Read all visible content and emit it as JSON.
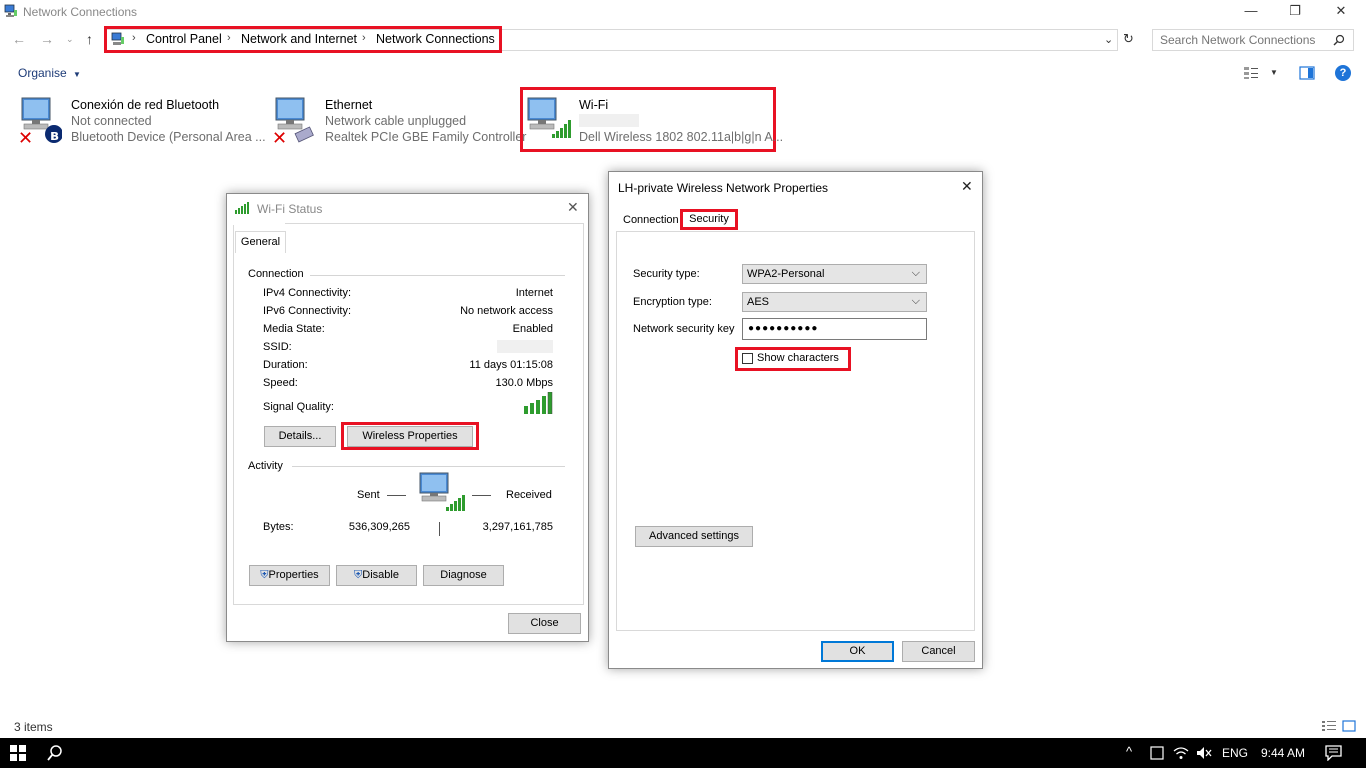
{
  "window": {
    "title": "Network Connections",
    "controls": {
      "minimize": "—",
      "maximize": "❐",
      "close": "✕"
    }
  },
  "address": {
    "crumbs": [
      "Control Panel",
      "Network and Internet",
      "Network Connections"
    ],
    "separator": "›"
  },
  "search": {
    "placeholder": "Search Network Connections"
  },
  "toolbar": {
    "organise_label": "Organise",
    "help_label": "?"
  },
  "connections": [
    {
      "name": "Conexión de red Bluetooth",
      "status": "Not connected",
      "device": "Bluetooth Device (Personal Area ..."
    },
    {
      "name": "Ethernet",
      "status": "Network cable unplugged",
      "device": "Realtek PCIe GBE Family Controller"
    },
    {
      "name": "Wi-Fi",
      "status": "",
      "device": "Dell Wireless 1802 802.11a|b|g|n A..."
    }
  ],
  "wifi_status": {
    "title": "Wi-Fi Status",
    "tab": "General",
    "connection_group": "Connection",
    "rows": [
      {
        "label": "IPv4 Connectivity:",
        "value": "Internet"
      },
      {
        "label": "IPv6 Connectivity:",
        "value": "No network access"
      },
      {
        "label": "Media State:",
        "value": "Enabled"
      },
      {
        "label": "SSID:",
        "value": ""
      },
      {
        "label": "Duration:",
        "value": "11 days 01:15:08"
      },
      {
        "label": "Speed:",
        "value": "130.0 Mbps"
      }
    ],
    "signal_label": "Signal Quality:",
    "details_btn": "Details...",
    "wireless_props_btn": "Wireless Properties",
    "activity_group": "Activity",
    "sent_label": "Sent",
    "received_label": "Received",
    "bytes_label": "Bytes:",
    "bytes_sent": "536,309,265",
    "bytes_received": "3,297,161,785",
    "properties_btn": "Properties",
    "disable_btn": "Disable",
    "diagnose_btn": "Diagnose",
    "close_btn": "Close"
  },
  "wireless_props": {
    "title": "LH-private Wireless Network Properties",
    "tabs": [
      "Connection",
      "Security"
    ],
    "security_type_label": "Security type:",
    "security_type_value": "WPA2-Personal",
    "encryption_type_label": "Encryption type:",
    "encryption_type_value": "AES",
    "key_label": "Network security key",
    "key_value": "●●●●●●●●●●",
    "show_chars_label": "Show characters",
    "advanced_btn": "Advanced settings",
    "ok_btn": "OK",
    "cancel_btn": "Cancel"
  },
  "statusbar": {
    "items_count": "3 items"
  },
  "taskbar": {
    "language": "ENG",
    "time": "9:44 AM"
  },
  "colors": {
    "highlight": "#e81123",
    "signal_green": "#2e9c2e",
    "link_blue": "#1e3c78",
    "taskbar": "#000000"
  }
}
